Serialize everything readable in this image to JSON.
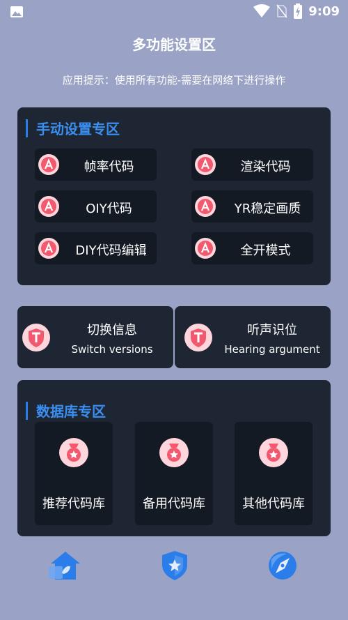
{
  "status": {
    "time": "9:09"
  },
  "header": {
    "title": "多功能设置区",
    "hint": "应用提示：使用所有功能-需要在网络下进行操作"
  },
  "manual": {
    "title": "手动设置专区",
    "buttons": [
      "帧率代码",
      "渲染代码",
      "OIY代码",
      "YR稳定画质",
      "DIY代码编辑",
      "全开模式"
    ]
  },
  "info": [
    {
      "title": "切换信息",
      "subtitle": "Switch versions"
    },
    {
      "title": "听声识位",
      "subtitle": "Hearing argument"
    }
  ],
  "database": {
    "title": "数据库专区",
    "items": [
      "推荐代码库",
      "备用代码库",
      "其他代码库"
    ]
  },
  "nav": [
    "home-icon",
    "shield-star-icon",
    "compass-icon"
  ],
  "colors": {
    "background": "#9aa3c6",
    "panel": "#1e2633",
    "accent": "#2b7de9",
    "badge": "#f2596f"
  }
}
